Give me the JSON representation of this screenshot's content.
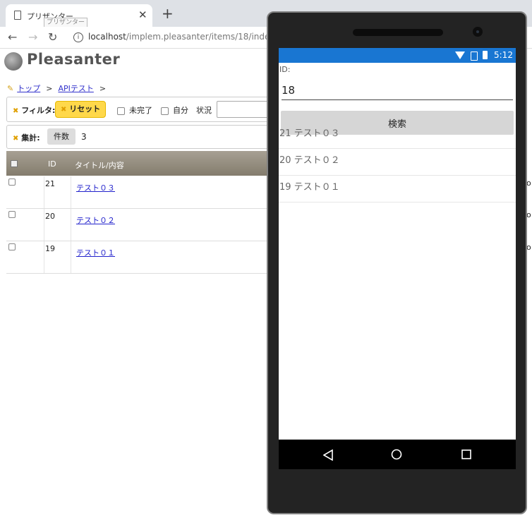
{
  "browser": {
    "tab_title": "プリザンター",
    "tab_close": "✕",
    "tooltip": "プリザンター",
    "new_tab": "+",
    "url_host": "localhost",
    "url_path": "/implem.pleasanter/items/18/index"
  },
  "web": {
    "logo_text": "Pleasanter",
    "breadcrumb": {
      "top": "トップ",
      "sep": ">",
      "api_test": "APIテスト"
    },
    "filter": {
      "label": "フィルタ:",
      "reset": "リセット",
      "incomplete": "未完了",
      "mine": "自分",
      "status": "状況"
    },
    "aggregate": {
      "label": "集計:",
      "count_label": "件数",
      "count_value": "3"
    },
    "grid": {
      "headers": [
        "ID",
        "タイトル/内容"
      ],
      "rows": [
        {
          "id": "21",
          "title": "テスト０３"
        },
        {
          "id": "20",
          "title": "テスト０２"
        },
        {
          "id": "19",
          "title": "テスト０１"
        }
      ],
      "edge_char": "o"
    }
  },
  "phone": {
    "status_time": "5:12",
    "id_label": "ID:",
    "id_value": "18",
    "search_button": "検索",
    "items": [
      "21 テスト０３",
      "20 テスト０２",
      "19 テスト０１"
    ]
  }
}
